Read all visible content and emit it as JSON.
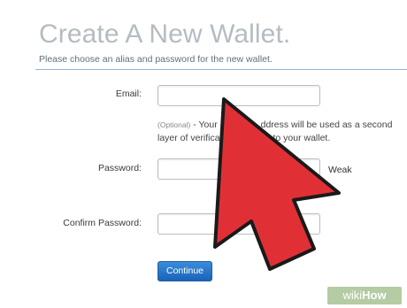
{
  "header": {
    "title": "Create A New Wallet.",
    "subtitle": "Please choose an alias and password for the new wallet."
  },
  "form": {
    "email_label": "Email:",
    "email_value": "",
    "help_optional": "(Optional)",
    "help_line1": " - Your ",
    "help_line1_end": "ddress will be used as a second",
    "help_line2": "layer of verifica",
    "help_line2_end": "u log into your wallet.",
    "password_label": "Password:",
    "password_value": "",
    "password_strength": "Weak",
    "confirm_label": "Confirm Password:",
    "confirm_value": "",
    "continue_label": "Continue"
  },
  "overlay": {
    "cursor_icon": "red-arrow-cursor-icon",
    "cursor_color": "#e03036",
    "watermark_a": "wiki",
    "watermark_b": "How"
  },
  "colors": {
    "title": "#b4bcc2",
    "divider": "#8fb3d6",
    "button": "#1a63b8"
  }
}
